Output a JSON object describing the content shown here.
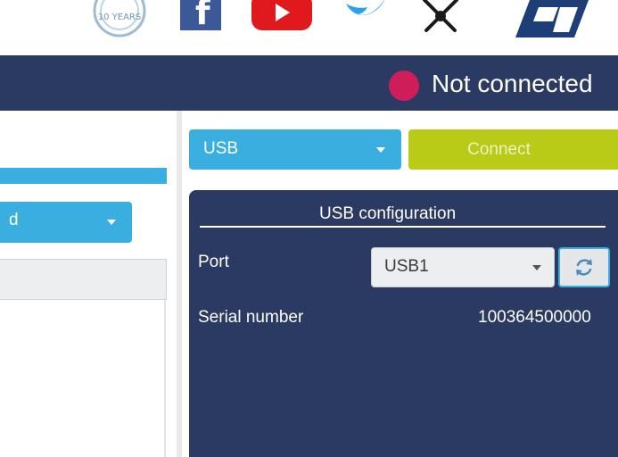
{
  "top_icons": [
    "anniversary-badge-icon",
    "facebook-icon",
    "youtube-icon",
    "twitter-icon",
    "community-hub-icon",
    "st-logo-icon"
  ],
  "anniversary_badge_text": "10 YEARS",
  "header": {
    "status_label": "Not connected",
    "status_color": "#cf1d5c",
    "background_color": "#2b3a63"
  },
  "left_panel": {
    "select_value_partial": "d"
  },
  "connection": {
    "interface_value": "USB",
    "connect_label": "Connect"
  },
  "usb_config": {
    "title": "USB configuration",
    "port_label": "Port",
    "port_value": "USB1",
    "serial_label": "Serial number",
    "serial_value": "100364500000"
  },
  "colors": {
    "accent_blue": "#3aafdf",
    "connect_green": "#b9cb16",
    "panel_navy": "#2b3a63"
  }
}
